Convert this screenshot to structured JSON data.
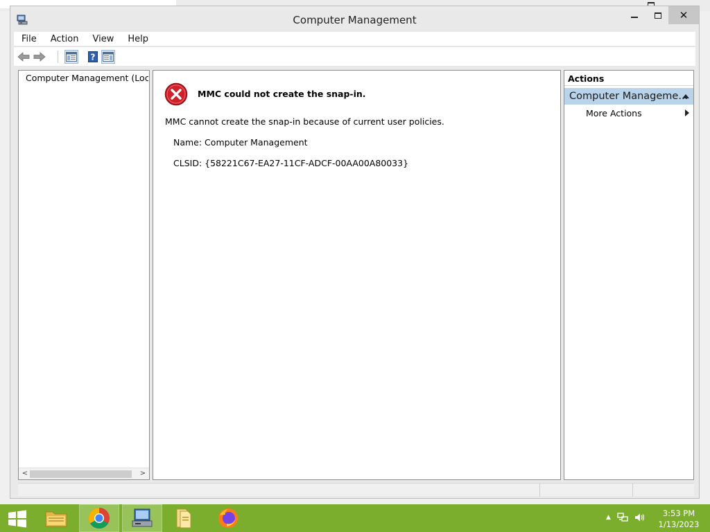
{
  "window": {
    "title": "Computer Management"
  },
  "menu": {
    "items": [
      "File",
      "Action",
      "View",
      "Help"
    ]
  },
  "tree": {
    "root_label": "Computer Management (Local"
  },
  "content": {
    "error_title": "MMC could not create the snap-in.",
    "error_message": "MMC cannot create the snap-in because of current user policies.",
    "name_line": "Name: Computer Management",
    "clsid_line": "CLSID: {58221C67-EA27-11CF-ADCF-00AA00A80033}"
  },
  "actions": {
    "header": "Actions",
    "section_title": "Computer Manageme...",
    "more_actions": "More Actions"
  },
  "taskbar": {
    "apps": [
      {
        "name": "file-explorer",
        "icon": "folder-icon",
        "active": false
      },
      {
        "name": "chrome",
        "icon": "chrome-icon",
        "active": true
      },
      {
        "name": "computer-management",
        "icon": "computer-management-icon",
        "active": true
      },
      {
        "name": "documents",
        "icon": "documents-icon",
        "active": false
      },
      {
        "name": "firefox",
        "icon": "firefox-icon",
        "active": false
      }
    ],
    "time": "3:53 PM",
    "date": "1/13/2023"
  },
  "colors": {
    "taskbar": "#7cae2e",
    "actions_section": "#b8d3ea",
    "error_red": "#d0202a"
  }
}
